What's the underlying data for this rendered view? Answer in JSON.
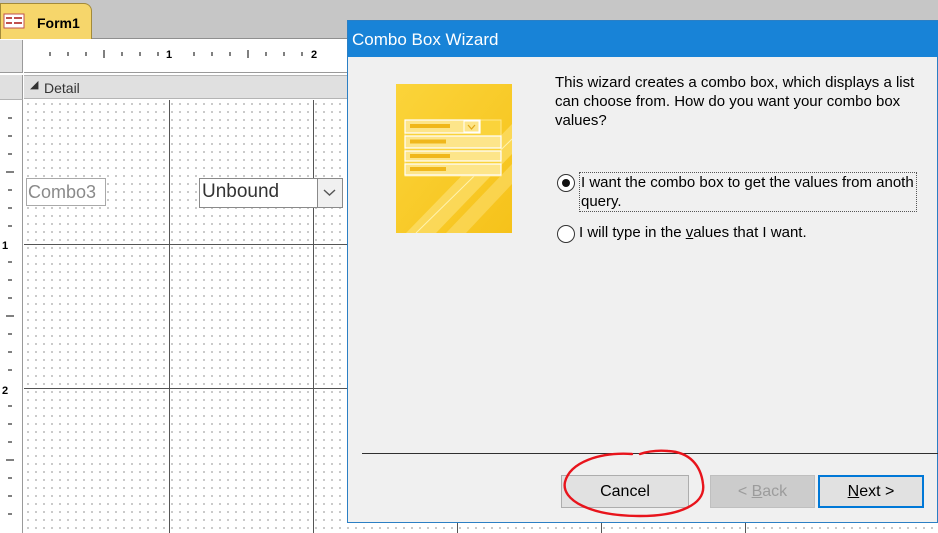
{
  "document_tab": {
    "label": "Form1",
    "icon": "form-icon"
  },
  "ruler": {
    "horizontal_numbers": [
      "1",
      "2"
    ],
    "vertical_numbers": [
      "1",
      "2"
    ]
  },
  "section": {
    "label": "Detail",
    "icon": "section-collapse-arrow-icon"
  },
  "form_controls": {
    "combo_label": "Combo3",
    "combo_value": "Unbound",
    "combo_dropdown_icon": "chevron-down-icon"
  },
  "dialog": {
    "title": "Combo Box Wizard",
    "intro_lines": [
      "This wizard creates a combo box, which displays a list",
      "can choose from.  How do you want your combo box",
      "values?"
    ],
    "options": [
      {
        "line1": "I want the combo box to get the values from anoth",
        "line2": "query.",
        "selected": true
      },
      {
        "line1_pre": "I will type in the ",
        "line1_ul": "v",
        "line1_post": "alues that I want.",
        "selected": false
      }
    ],
    "buttons": {
      "cancel": "Cancel",
      "back_prefix": "< ",
      "back_ul": "B",
      "back_rest": "ack",
      "next_ul": "N",
      "next_rest": "ext >"
    }
  },
  "colors": {
    "titlebar": "#1883d7",
    "tab_active": "#f6d66b",
    "annotation_circle": "#e8141c",
    "default_button_border": "#0078d7"
  }
}
